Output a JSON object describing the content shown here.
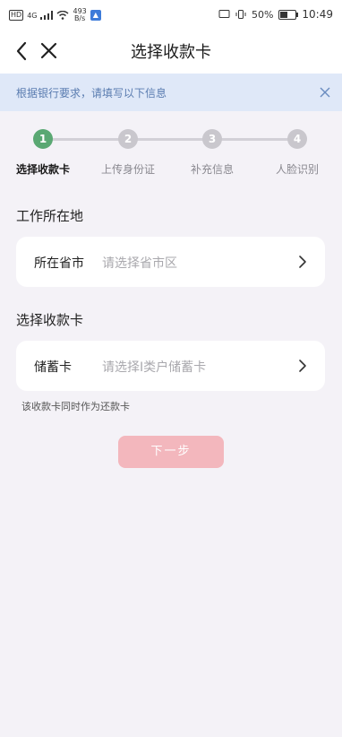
{
  "status_bar": {
    "hd": "HD",
    "net": "4G",
    "speed_value": "493",
    "speed_unit": "B/s",
    "battery": "50%",
    "time": "10:49",
    "battery_level": 0.5
  },
  "nav": {
    "title": "选择收款卡"
  },
  "notice": {
    "text": "根据银行要求，请填写以下信息"
  },
  "steps": [
    {
      "number": "1",
      "label": "选择收款卡",
      "active": true
    },
    {
      "number": "2",
      "label": "上传身份证",
      "active": false
    },
    {
      "number": "3",
      "label": "补充信息",
      "active": false
    },
    {
      "number": "4",
      "label": "人脸识别",
      "active": false
    }
  ],
  "work_location": {
    "section_title": "工作所在地",
    "field_label": "所在省市",
    "placeholder": "请选择省市区"
  },
  "card_select": {
    "section_title": "选择收款卡",
    "field_label": "储蓄卡",
    "placeholder": "请选择I类户储蓄卡",
    "hint": "该收款卡同时作为还款卡"
  },
  "actions": {
    "next_label": "下一步"
  },
  "colors": {
    "accent_active_step": "#5aa873",
    "button_disabled": "#f3b7bd",
    "notice_bg": "#dfe8f8",
    "notice_text": "#5a7cb0"
  }
}
